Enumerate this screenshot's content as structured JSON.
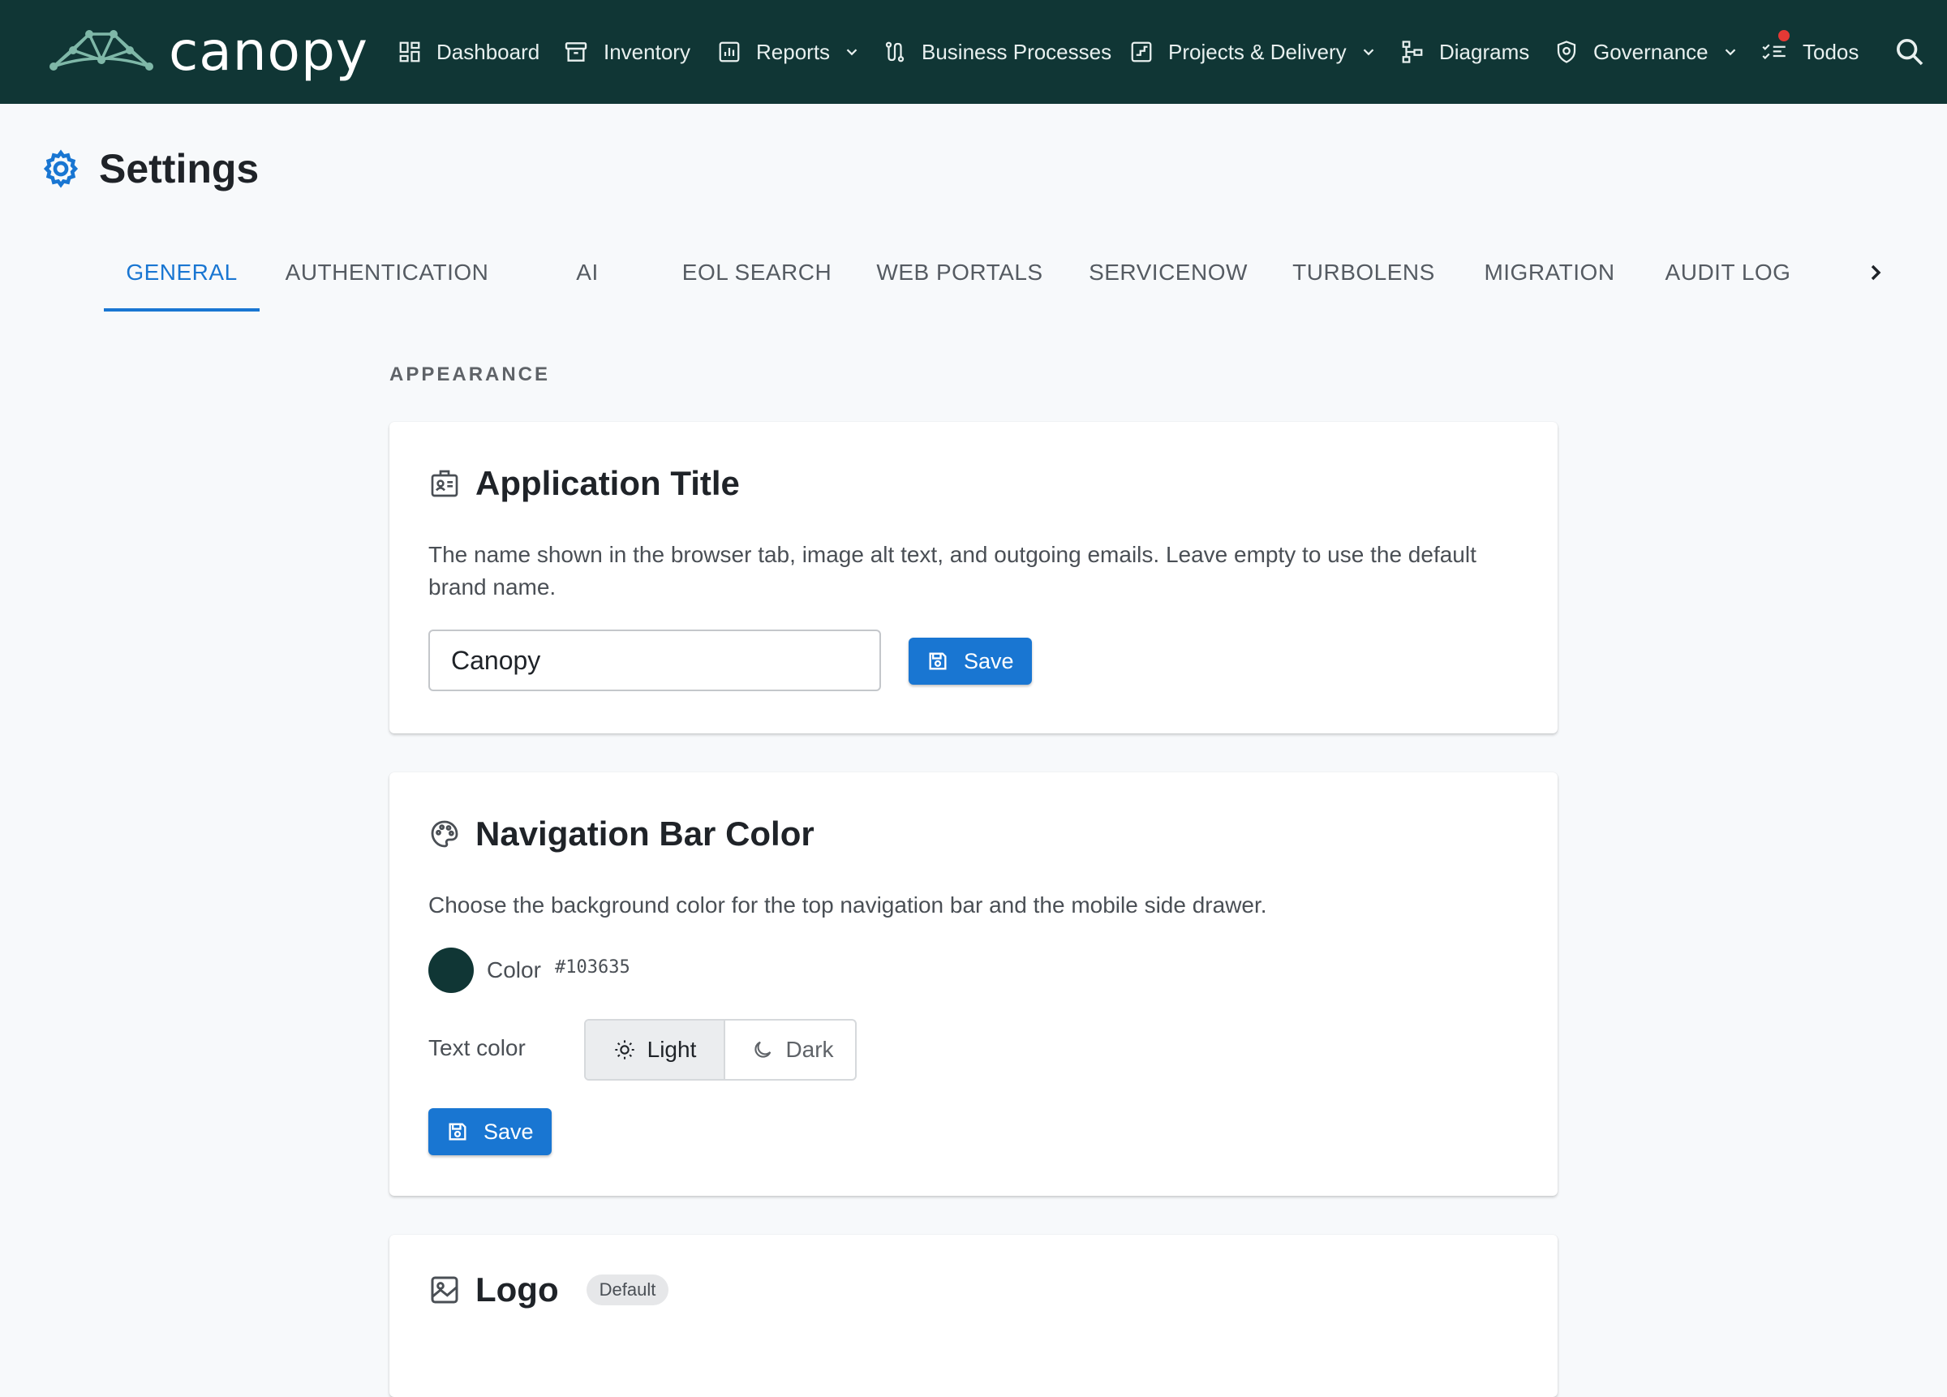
{
  "brand": {
    "name": "canopy"
  },
  "nav": {
    "items": [
      {
        "label": "Dashboard",
        "icon": "dashboard-icon"
      },
      {
        "label": "Inventory",
        "icon": "inventory-icon"
      },
      {
        "label": "Reports",
        "icon": "reports-icon",
        "has_dropdown": true
      },
      {
        "label": "Business Processes",
        "icon": "process-icon"
      },
      {
        "label": "Projects & Delivery",
        "icon": "projects-icon",
        "has_dropdown": true
      },
      {
        "label": "Diagrams",
        "icon": "diagrams-icon"
      },
      {
        "label": "Governance",
        "icon": "governance-icon",
        "has_dropdown": true
      },
      {
        "label": "Todos",
        "icon": "todos-icon",
        "notification": true
      }
    ],
    "search_icon": "search-icon",
    "colors": {
      "background": "#103635",
      "text": "#ffffff",
      "notification": "#e53935"
    }
  },
  "page": {
    "title": "Settings",
    "icon": "gear-icon",
    "accent": "#1976d2"
  },
  "tabs": {
    "items": [
      "GENERAL",
      "AUTHENTICATION",
      "AI",
      "EOL SEARCH",
      "WEB PORTALS",
      "SERVICENOW",
      "TURBOLENS",
      "MIGRATION",
      "AUDIT LOG"
    ],
    "active": "GENERAL"
  },
  "section": {
    "label": "APPEARANCE"
  },
  "app_title_card": {
    "title": "Application Title",
    "icon": "id-badge-icon",
    "description": "The name shown in the browser tab, image alt text, and outgoing emails. Leave empty to use the default brand name.",
    "input_value": "Canopy",
    "save_label": "Save"
  },
  "nav_color_card": {
    "title": "Navigation Bar Color",
    "icon": "palette-icon",
    "description": "Choose the background color for the top navigation bar and the mobile side drawer.",
    "color_label": "Color",
    "color_value": "#103635",
    "text_color_label": "Text color",
    "options": [
      {
        "label": "Light",
        "icon": "sun-icon",
        "selected": true
      },
      {
        "label": "Dark",
        "icon": "moon-icon",
        "selected": false
      }
    ],
    "save_label": "Save"
  },
  "logo_card": {
    "title": "Logo",
    "icon": "image-icon",
    "badge": "Default"
  }
}
